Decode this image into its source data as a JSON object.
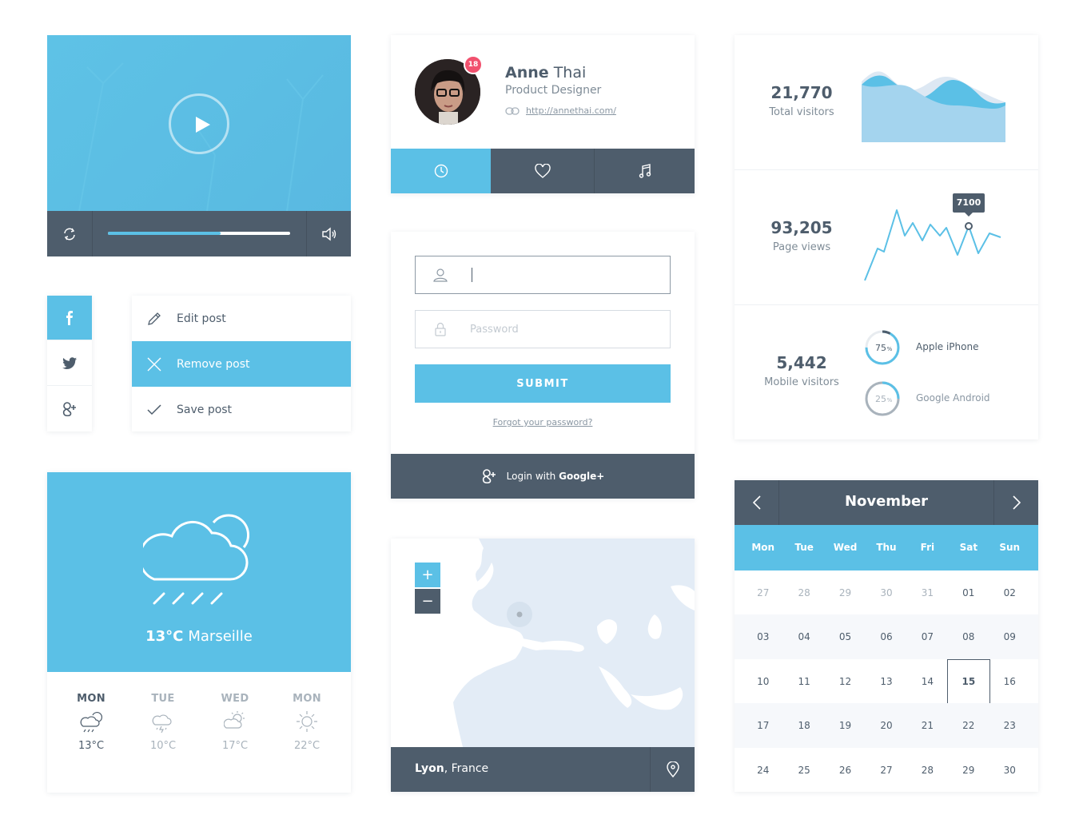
{
  "colors": {
    "accent": "#5bc0e6",
    "dark": "#4e5d6c",
    "badge": "#f1516e",
    "muted": "#a9b3bc"
  },
  "video": {
    "progress": 0.62,
    "icons": [
      "refresh-icon",
      "play-icon",
      "volume-icon"
    ]
  },
  "social": [
    {
      "name": "facebook",
      "glyph": "f"
    },
    {
      "name": "twitter",
      "glyph": "twitter"
    },
    {
      "name": "google-plus",
      "glyph": "g+"
    }
  ],
  "menu": {
    "items": [
      {
        "label": "Edit post"
      },
      {
        "label": "Remove post"
      },
      {
        "label": "Save post"
      }
    ]
  },
  "weather": {
    "current": {
      "temp": "13°C",
      "city": "Marseille"
    },
    "forecast": [
      {
        "day": "MON",
        "temp": "13°C",
        "icon": "cloud-rain-icon"
      },
      {
        "day": "TUE",
        "temp": "10°C",
        "icon": "cloud-storm-icon"
      },
      {
        "day": "WED",
        "temp": "17°C",
        "icon": "cloud-sun-icon"
      },
      {
        "day": "MON",
        "temp": "22°C",
        "icon": "sun-icon"
      }
    ]
  },
  "profile": {
    "first_name": "Anne",
    "last_name": "Thai",
    "role": "Product Designer",
    "url": "http://annethai.com/",
    "badge": "18",
    "tabs": [
      "clock-icon",
      "heart-icon",
      "music-icon"
    ]
  },
  "login": {
    "username_placeholder": "",
    "password_placeholder": "Password",
    "submit": "SUBMIT",
    "forgot": "Forgot your password?",
    "google_prefix": "Login with",
    "google_brand": "Google+"
  },
  "map": {
    "zoom_in": "+",
    "zoom_out": "−",
    "city": "Lyon",
    "country": ", France"
  },
  "stats": {
    "total": {
      "value": "21,770",
      "label": "Total visitors"
    },
    "pageviews": {
      "value": "93,205",
      "label": "Page views",
      "tooltip": "7100"
    },
    "mobile": {
      "value": "5,442",
      "label": "Mobile visitors",
      "devices": [
        {
          "name": "Apple iPhone",
          "percent": 75,
          "pct_label": "75",
          "sign": "%"
        },
        {
          "name": "Google Android",
          "percent": 25,
          "pct_label": "25",
          "sign": "%"
        }
      ]
    }
  },
  "calendar": {
    "month": "November",
    "dows": [
      "Mon",
      "Tue",
      "Wed",
      "Thu",
      "Fri",
      "Sat",
      "Sun"
    ],
    "weeks": [
      [
        "27",
        "28",
        "29",
        "30",
        "31",
        "01",
        "02"
      ],
      [
        "03",
        "04",
        "05",
        "06",
        "07",
        "08",
        "09"
      ],
      [
        "10",
        "11",
        "12",
        "13",
        "14",
        "15",
        "16"
      ],
      [
        "17",
        "18",
        "19",
        "20",
        "21",
        "22",
        "23"
      ],
      [
        "24",
        "25",
        "26",
        "27",
        "28",
        "29",
        "30"
      ]
    ],
    "muted_first_week": 5,
    "today": "15"
  }
}
